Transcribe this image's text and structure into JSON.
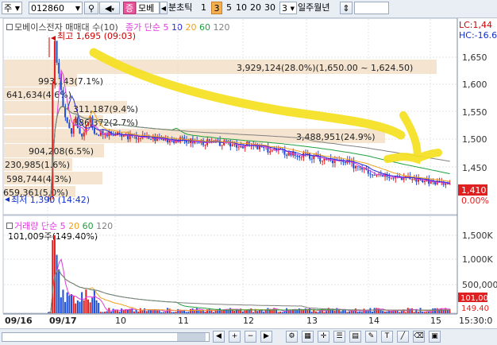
{
  "toolbar": {
    "market": "주",
    "code": "012860",
    "stock_tag": "증",
    "stock_name": "모베",
    "period_label": "분초틱",
    "periods": [
      "1",
      "3",
      "5",
      "10",
      "20",
      "30"
    ],
    "selected_period": "3",
    "count": "3",
    "cycle": "일주월년"
  },
  "price_panel": {
    "title": "모베이스전자 매매대 수(10)",
    "legend_name": "종가 단순",
    "ma_periods": [
      "5",
      "10",
      "20",
      "60",
      "120"
    ],
    "ma_colors": [
      "#e03ce0",
      "#2a2ad8",
      "#f0a020",
      "#20a040",
      "#808080"
    ],
    "lc_label": "LC:1,44",
    "hc_label": "HC:-16.6",
    "high_marker": "최고 1,695 (09:03)",
    "low_marker": "최저 1,390 (14:42)",
    "current_price": "1,410",
    "current_change": "0.00%",
    "y_ticks": [
      "1,650",
      "1,600",
      "1,550",
      "1,500",
      "1,450",
      "1,400"
    ],
    "volume_profile": [
      {
        "label": "3,929,124(28.0%)(1,650.00 ~ 1,624.50)"
      },
      {
        "label": "993,143(7.1%)"
      },
      {
        "label": "641,634(4.6%)"
      },
      {
        "label": "311,187(9.4%)"
      },
      {
        "label": "386,372(2.7%)"
      },
      {
        "label": "3,488,951(24.9%)"
      },
      {
        "label": "904,208(6.5%)"
      },
      {
        "label": "230,985(1.6%)"
      },
      {
        "label": "598,744(4.3%)"
      },
      {
        "label": "659,361(5.0%)"
      }
    ]
  },
  "volume_panel": {
    "title": "거래량 단순",
    "ma_periods": [
      "5",
      "20",
      "60",
      "120"
    ],
    "ma_colors": [
      "#e03ce0",
      "#f0a020",
      "#20a040",
      "#808080"
    ],
    "value_label": "101,009주(149.40%)",
    "y_ticks": [
      "1,500K",
      "1,000K",
      "500,000"
    ],
    "current_volume": "101,00",
    "current_pct": "149.40"
  },
  "x_axis": {
    "labels": [
      "09/16",
      "09/17",
      "10",
      "11",
      "12",
      "13",
      "14",
      "15",
      "15:30:0"
    ]
  }
}
